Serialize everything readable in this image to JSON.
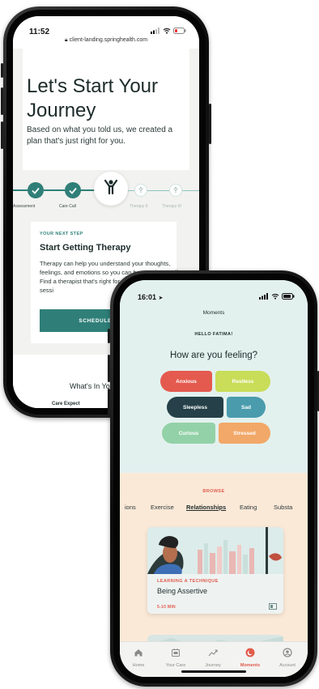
{
  "phone_left": {
    "status": {
      "time": "11:52",
      "url": "client-landing.springhealth.com"
    },
    "hero": {
      "title": "Let's Start Your Journey",
      "subtitle": "Based on what you told us, we created a plan that's just right for you."
    },
    "steps": [
      {
        "label": "Assessment",
        "state": "done"
      },
      {
        "label": "Care Call",
        "state": "done"
      },
      {
        "label": "",
        "state": "current"
      },
      {
        "label": "Therapy II",
        "state": "upcoming"
      },
      {
        "label": "Therapy III",
        "state": "upcoming"
      }
    ],
    "next_step": {
      "eyebrow": "YOUR NEXT STEP",
      "title": "Start Getting Therapy",
      "body": "Therapy can help you understand your thoughts, feelings, and emotions so you can be your best self. Find a therapist that's right for you, and book your first sessi",
      "button": "SCHEDULE THERAPY"
    },
    "lower": {
      "heading": "What's In Yo",
      "sub": "Care Expect"
    },
    "colors": {
      "teal": "#2f7f78"
    }
  },
  "phone_right": {
    "status": {
      "time": "16:01"
    },
    "header": {
      "title": "Moments"
    },
    "greeting": "HELLO FATIMA!",
    "question": "How are you feeling?",
    "moods": [
      {
        "label": "Anxious",
        "color": "#e45a4f"
      },
      {
        "label": "Restless",
        "color": "#c9dd58"
      },
      {
        "label": "Sleepless",
        "color": "#254048"
      },
      {
        "label": "Sad",
        "color": "#4a9cad"
      },
      {
        "label": "Curious",
        "color": "#93d2a8"
      },
      {
        "label": "Stressed",
        "color": "#f2a868"
      }
    ],
    "browse": {
      "label": "BROWSE",
      "tabs": [
        {
          "label": "ions",
          "active": false
        },
        {
          "label": "Exercise",
          "active": false
        },
        {
          "label": "Relationships",
          "active": true
        },
        {
          "label": "Eating",
          "active": false
        },
        {
          "label": "Substa",
          "active": false
        }
      ]
    },
    "card": {
      "eyebrow": "LEARNING A TECHNIQUE",
      "title": "Being Assertive",
      "duration": "5-10 MIN"
    },
    "tabbar": [
      {
        "label": "Home",
        "icon": "home-icon",
        "active": false
      },
      {
        "label": "Your Care",
        "icon": "calendar-icon",
        "active": false
      },
      {
        "label": "Journey",
        "icon": "trend-icon",
        "active": false
      },
      {
        "label": "Moments",
        "icon": "moments-icon",
        "active": true
      },
      {
        "label": "Account",
        "icon": "account-icon",
        "active": false
      }
    ],
    "colors": {
      "accent": "#e15b4b",
      "mint": "#e3f1ee",
      "peach": "#fbe9d8"
    }
  }
}
